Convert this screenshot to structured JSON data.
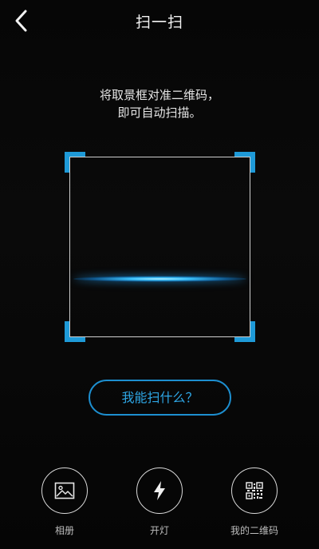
{
  "header": {
    "title": "扫一扫",
    "back_icon": "chevron-left-icon"
  },
  "instructions": {
    "line1": "将取景框对准二维码，",
    "line2": "即可自动扫描。"
  },
  "scanner": {
    "accent_color": "#1e9ad8",
    "frame_color": "#cfcfcf",
    "scan_line_color": "#3cc4ff"
  },
  "help_button": {
    "label": "我能扫什么？"
  },
  "actions": [
    {
      "label": "相册",
      "icon": "image-icon"
    },
    {
      "label": "开灯",
      "icon": "flash-icon"
    },
    {
      "label": "我的二维码",
      "icon": "qr-code-icon"
    }
  ]
}
